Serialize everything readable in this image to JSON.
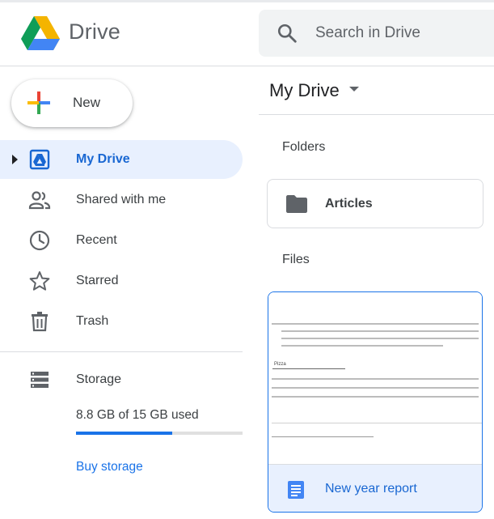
{
  "header": {
    "brand": "Drive",
    "search_placeholder": "Search in Drive"
  },
  "new_button": {
    "label": "New"
  },
  "sidebar": {
    "items": [
      {
        "label": "My Drive",
        "icon": "my-drive-icon",
        "active": true
      },
      {
        "label": "Shared with me",
        "icon": "people-icon",
        "active": false
      },
      {
        "label": "Recent",
        "icon": "clock-icon",
        "active": false
      },
      {
        "label": "Starred",
        "icon": "star-icon",
        "active": false
      },
      {
        "label": "Trash",
        "icon": "trash-icon",
        "active": false
      }
    ],
    "storage": {
      "label": "Storage",
      "icon": "storage-icon",
      "usage_text": "8.8 GB of 15 GB used",
      "used_fraction": 0.58,
      "buy_label": "Buy storage"
    }
  },
  "main": {
    "title": "My Drive",
    "folders_label": "Folders",
    "folders": [
      {
        "name": "Articles",
        "icon": "folder-icon"
      }
    ],
    "files_label": "Files",
    "files": [
      {
        "name": "New year report",
        "icon": "docs-icon",
        "preview_heading": "Pizza"
      }
    ]
  },
  "colors": {
    "accent": "#1a73e8",
    "active_bg": "#e8f0fe",
    "active_text": "#1967d2",
    "logo_green": "#0f9d58",
    "logo_yellow": "#f4b400",
    "logo_blue": "#4285f4"
  }
}
